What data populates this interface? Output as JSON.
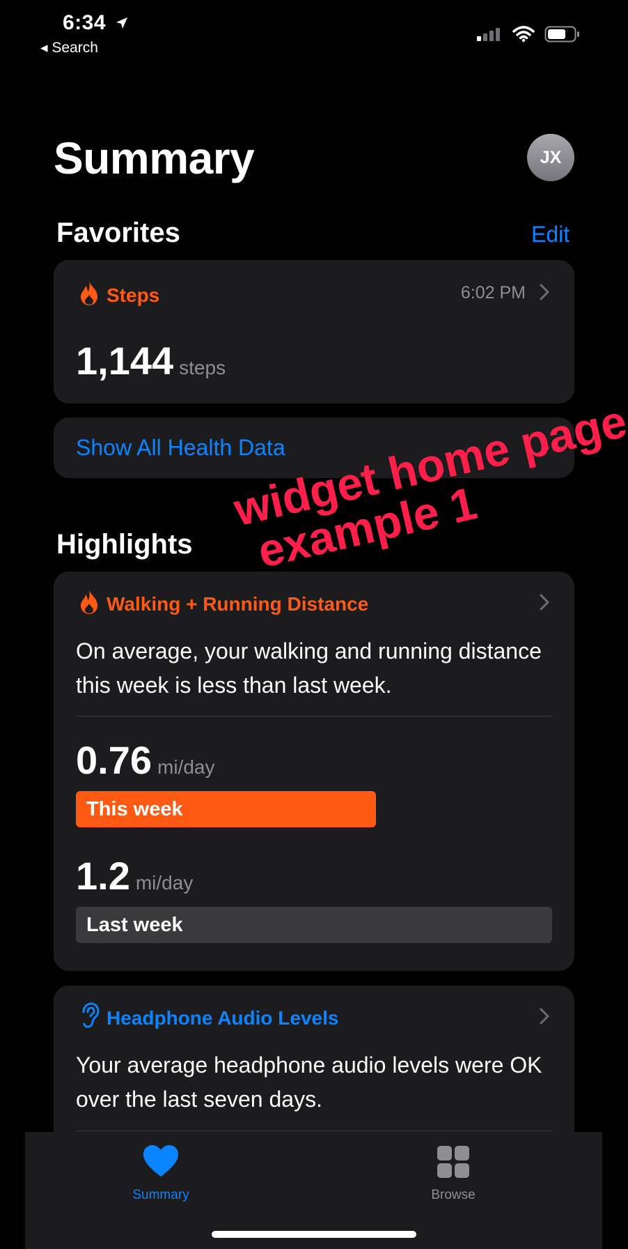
{
  "status_bar": {
    "time": "6:34",
    "back_label": "◂ Search"
  },
  "header": {
    "title": "Summary",
    "avatar_initials": "JX"
  },
  "favorites": {
    "title": "Favorites",
    "edit_label": "Edit",
    "steps_card": {
      "label": "Steps",
      "time": "6:02 PM",
      "value": "1,144",
      "unit": "steps"
    },
    "show_all_label": "Show All Health Data"
  },
  "highlights": {
    "title": "Highlights",
    "walking_card": {
      "label": "Walking + Running Distance",
      "description": "On average, your walking and running distance this week is less than last week.",
      "this_week": {
        "value": "0.76",
        "unit": "mi/day",
        "bar_label": "This week",
        "bar_fraction": 0.63
      },
      "last_week": {
        "value": "1.2",
        "unit": "mi/day",
        "bar_label": "Last week",
        "bar_fraction": 1.0
      }
    },
    "headphone_card": {
      "label": "Headphone Audio Levels",
      "description": "Your average headphone audio levels were OK over the last seven days."
    }
  },
  "tab_bar": {
    "tabs": [
      {
        "label": "Summary"
      },
      {
        "label": "Browse"
      }
    ]
  },
  "overlay": {
    "line1": "widget home page",
    "line2": "example 1"
  },
  "colors": {
    "accent_blue": "#0a84ff",
    "activity_orange": "#ff5a14",
    "card_bg": "#1c1c1e",
    "overlay_red": "#ff1f4a"
  }
}
